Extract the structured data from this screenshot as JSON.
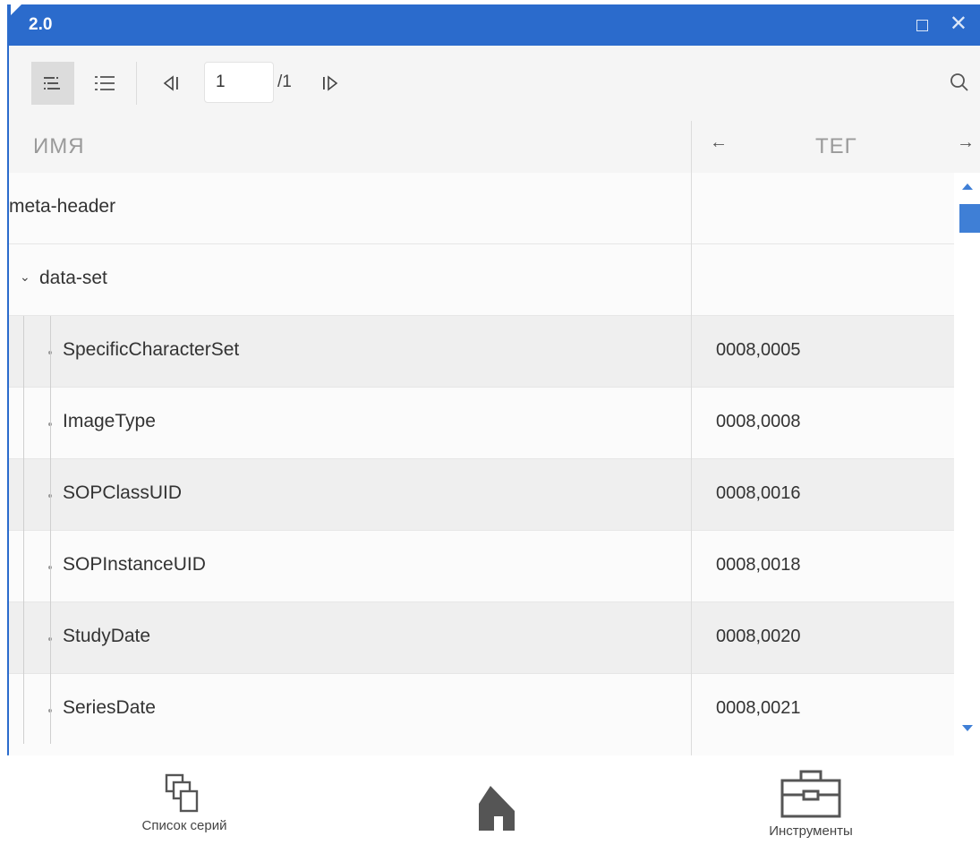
{
  "window": {
    "title": "2.0"
  },
  "toolbar": {
    "tree_view_icon": "tree-view-icon",
    "list_view_icon": "list-view-icon",
    "prev_page_icon": "prev-page-icon",
    "next_page_icon": "next-page-icon",
    "page_value": "1",
    "page_total": "/1",
    "search_icon": "search-icon"
  },
  "table": {
    "columns": {
      "name": "ИМЯ",
      "tag": "ТЕГ"
    },
    "rows": [
      {
        "name": "meta-header",
        "tag": ""
      },
      {
        "name": "data-set",
        "tag": ""
      },
      {
        "name": "SpecificCharacterSet",
        "tag": "0008,0005"
      },
      {
        "name": "ImageType",
        "tag": "0008,0008"
      },
      {
        "name": "SOPClassUID",
        "tag": "0008,0016"
      },
      {
        "name": "SOPInstanceUID",
        "tag": "0008,0018"
      },
      {
        "name": "StudyDate",
        "tag": "0008,0020"
      },
      {
        "name": "SeriesDate",
        "tag": "0008,0021"
      }
    ]
  },
  "bottombar": {
    "series_list_label": "Список серий",
    "tools_label": "Инструменты"
  },
  "colors": {
    "accent": "#2b6bcc",
    "scroll": "#3f7fd6"
  }
}
